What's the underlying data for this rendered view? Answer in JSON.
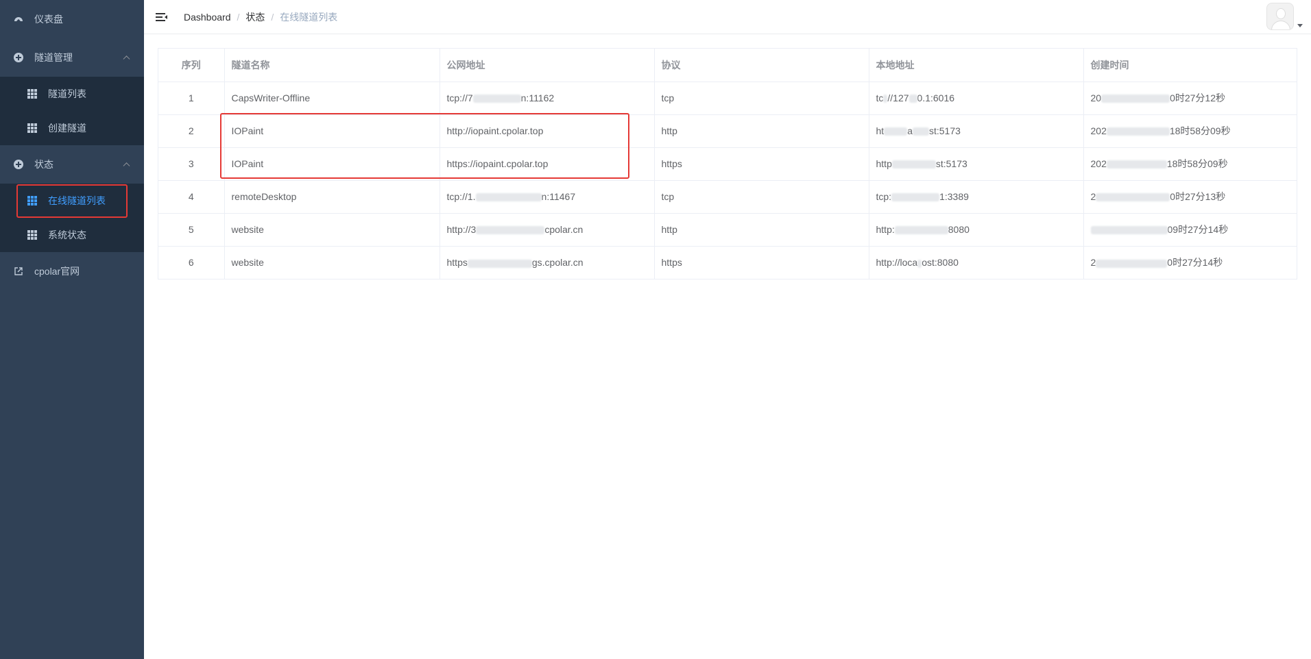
{
  "sidebar": {
    "dashboard": "仪表盘",
    "tunnel_mgmt": "隧道管理",
    "tunnel_list": "隧道列表",
    "create_tunnel": "创建隧道",
    "status": "状态",
    "online_list": "在线隧道列表",
    "system_status": "系统状态",
    "official_site": "cpolar官网"
  },
  "breadcrumb": [
    "Dashboard",
    "状态",
    "在线隧道列表"
  ],
  "table": {
    "headers": [
      "序列",
      "隧道名称",
      "公网地址",
      "协议",
      "本地地址",
      "创建时间"
    ],
    "rows": [
      {
        "idx": "1",
        "name": "CapsWriter-Offline",
        "pub_a": "tcp://7",
        "pub_b": "n:11162",
        "proto": "tcp",
        "local_a": "tc",
        "local_b": "//127",
        "local_c": "0.1:6016",
        "time_a": "20",
        "time_b": "0时27分12秒"
      },
      {
        "idx": "2",
        "name": "IOPaint",
        "pub_a": "http://iopaint.cpolar.top",
        "pub_b": "",
        "proto": "http",
        "local_a": "ht",
        "local_b": "a",
        "local_c": "st:5173",
        "time_a": "202",
        "time_b": "18时58分09秒"
      },
      {
        "idx": "3",
        "name": "IOPaint",
        "pub_a": "https://iopaint.cpolar.top",
        "pub_b": "",
        "proto": "https",
        "local_a": "http",
        "local_b": "",
        "local_c": "st:5173",
        "time_a": "202",
        "time_b": "18时58分09秒"
      },
      {
        "idx": "4",
        "name": "remoteDesktop",
        "pub_a": "tcp://1.",
        "pub_b": "n:11467",
        "proto": "tcp",
        "local_a": "tcp:",
        "local_b": "",
        "local_c": "1:3389",
        "time_a": "2",
        "time_b": "0时27分13秒"
      },
      {
        "idx": "5",
        "name": "website",
        "pub_a": "http://3",
        "pub_b": "cpolar.cn",
        "proto": "http",
        "local_a": "http:",
        "local_b": "",
        "local_c": "8080",
        "time_a": "",
        "time_b": "09时27分14秒"
      },
      {
        "idx": "6",
        "name": "website",
        "pub_a": "https",
        "pub_b": "gs.cpolar.cn",
        "proto": "https",
        "local_a": "http://loca",
        "local_b": "",
        "local_c": "ost:8080",
        "time_a": "2",
        "time_b": "0时27分14秒"
      }
    ]
  },
  "colors": {
    "sidebar_bg": "#304156",
    "submenu_bg": "#1f2d3d",
    "active": "#409eff",
    "highlight": "#e53935"
  },
  "icons": {
    "dashboard": "dashboard-icon",
    "tunnel_mgmt": "plus-circle-icon",
    "grid": "grid-icon",
    "external": "external-link-icon",
    "menu": "hamburger-icon"
  }
}
